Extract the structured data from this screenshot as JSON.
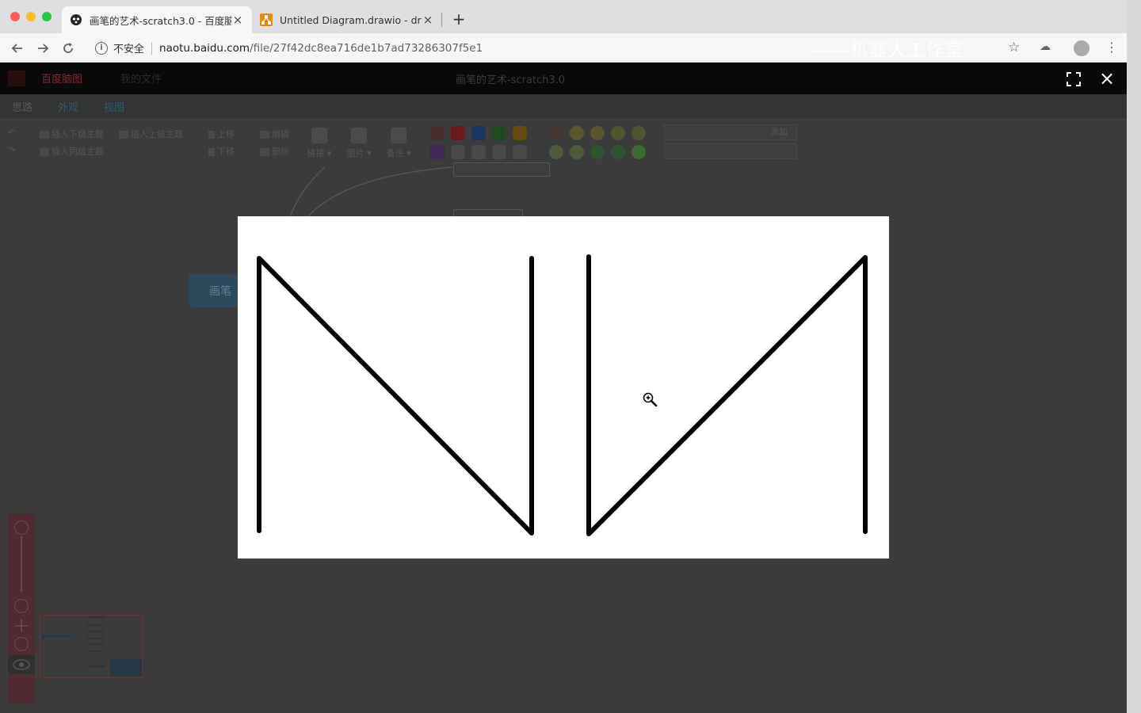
{
  "browser": {
    "tabs": [
      {
        "title": "画笔的艺术-scratch3.0 - 百度脑",
        "active": true,
        "favicon": "baidu-paw-icon"
      },
      {
        "title": "Untitled Diagram.drawio - draw",
        "active": false,
        "favicon": "drawio-icon"
      }
    ],
    "new_tab_label": "+",
    "close_label": "×",
    "security_label": "不安全",
    "url_host": "naotu.baidu.com",
    "url_path": "/file/27f42dc8ea716de1b7ad73286307f5e1",
    "watermark": "——机器人工作室"
  },
  "app": {
    "header_center": "画笔的艺术-scratch3.0",
    "header_left": "百度脑图",
    "header_file": "我的文件",
    "tabs": [
      "思路",
      "外观",
      "视图"
    ],
    "ribbon": {
      "insert_child": "插入下级主题",
      "insert_parent": "插入上级主题",
      "insert_sibling": "插入同级主题",
      "move_up": "上移",
      "move_down": "下移",
      "edit": "编辑",
      "delete": "删除",
      "link": "链接",
      "image": "图片",
      "note": "备注",
      "add": "添加"
    },
    "canvas_node": "画笔",
    "colors": {
      "priority": [
        "#7a1a1a",
        "#1a3a7a",
        "#1f5a1f",
        "#8a5a10",
        "#4a2a6a"
      ],
      "header_bg": "#0a0a0a",
      "lightbox_bg": "#ffffff"
    }
  },
  "lightbox": {
    "close_label": "×",
    "fullscreen_icon": "fullscreen-icon",
    "image_description_icon": "zoom-in-cursor-icon"
  }
}
